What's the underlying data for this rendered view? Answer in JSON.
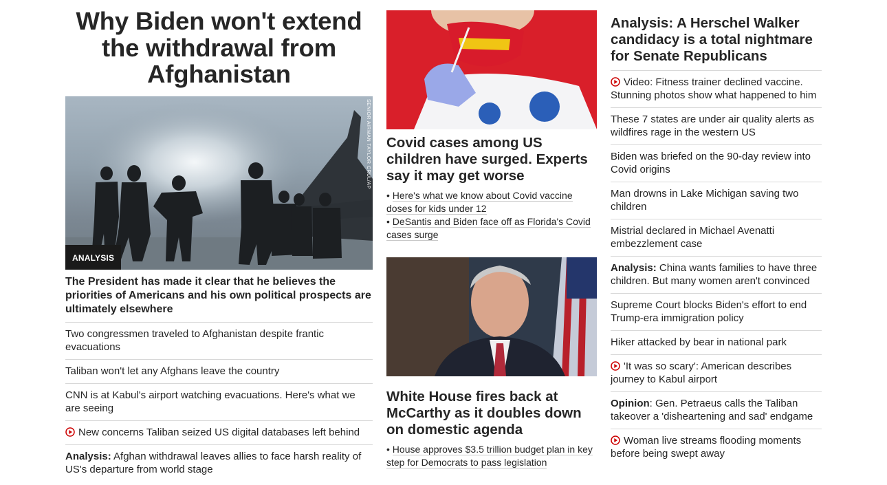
{
  "left": {
    "headline": "Why Biden won't extend the withdrawal from Afghanistan",
    "badge": "ANALYSIS",
    "photo_credit": "SENIOR AIRMAN TAYLOR CRUL/AP",
    "lead": "The President has made it clear that he believes the priorities of Americans and his own political prospects are ultimately elsewhere",
    "stories": [
      {
        "prefix": "",
        "text": "Two congressmen traveled to Afghanistan despite frantic evacuations",
        "video": false
      },
      {
        "prefix": "",
        "text": "Taliban won't let any Afghans leave the country",
        "video": false
      },
      {
        "prefix": "",
        "text": "CNN is at Kabul's airport watching evacuations. Here's what we are seeing",
        "video": false
      },
      {
        "prefix": "",
        "text": "New concerns Taliban seized US digital databases left behind",
        "video": true
      },
      {
        "prefix": "Analysis:",
        "text": " Afghan withdrawal leaves allies to face harsh reality of US's departure from world stage",
        "video": false
      }
    ]
  },
  "middle": {
    "covid_headline": "Covid cases among US children have surged. Experts say it may get worse",
    "covid_bullets": [
      "Here's what we know about Covid vaccine doses for kids under 12",
      "DeSantis and Biden face off as Florida's Covid cases surge"
    ],
    "wh_headline": "White House fires back at McCarthy as it doubles down on domestic agenda",
    "wh_bullets": [
      "House approves $3.5 trillion budget plan in key step for Democrats to pass legislation"
    ]
  },
  "right": {
    "headline": "Analysis: A Herschel Walker candidacy is a total nightmare for Senate Republicans",
    "stories": [
      {
        "prefix": "",
        "text": "Video: Fitness trainer declined vaccine. Stunning photos show what happened to him",
        "video": true
      },
      {
        "prefix": "",
        "text": "These 7 states are under air quality alerts as wildfires rage in the western US",
        "video": false
      },
      {
        "prefix": "",
        "text": "Biden was briefed on the 90-day review into Covid origins",
        "video": false
      },
      {
        "prefix": "",
        "text": "Man drowns in Lake Michigan saving two children",
        "video": false
      },
      {
        "prefix": "",
        "text": "Mistrial declared in Michael Avenatti embezzlement case",
        "video": false
      },
      {
        "prefix": "Analysis:",
        "text": " China wants families to have three children. But many women aren't convinced",
        "video": false
      },
      {
        "prefix": "",
        "text": "Supreme Court blocks Biden's effort to end Trump-era immigration policy",
        "video": false
      },
      {
        "prefix": "",
        "text": "Hiker attacked by bear in national park",
        "video": false
      },
      {
        "prefix": "",
        "text": "'It was so scary': American describes journey to Kabul airport",
        "video": true
      },
      {
        "prefix": "Opinion",
        "text": ": Gen. Petraeus calls the Taliban takeover a 'disheartening and sad' endgame",
        "video": false
      },
      {
        "prefix": "",
        "text": "Woman live streams flooding moments before being swept away",
        "video": true
      }
    ]
  },
  "colors": {
    "accent_red": "#cc0000",
    "text": "#262626",
    "divider": "#d8d8d8"
  }
}
